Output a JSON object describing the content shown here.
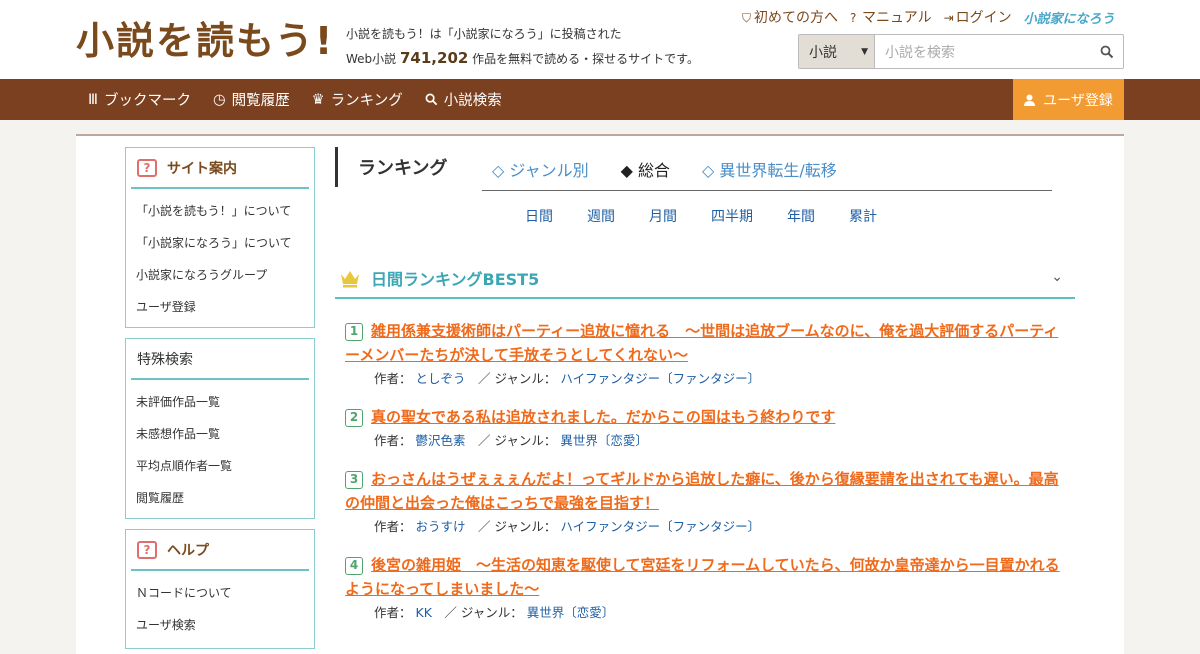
{
  "header": {
    "logo_text": "小説を読もう!",
    "tagline_line1": "小説を読もう！は「小説家になろう」に投稿された",
    "tagline_prefix": "Web小説",
    "work_count": "741,202",
    "tagline_suffix": "作品を無料で読める・探せるサイトです。",
    "links": [
      {
        "label": "初めての方へ",
        "icon": "shield-icon"
      },
      {
        "label": "マニュアル",
        "icon": "question-circle-icon"
      },
      {
        "label": "ログイン",
        "icon": "login-icon"
      }
    ],
    "partner_logo": "小説家になろう",
    "search": {
      "select_value": "小説",
      "placeholder": "小説を検索"
    }
  },
  "nav": {
    "items": [
      {
        "label": "ブックマーク",
        "icon": "bookmark-icon"
      },
      {
        "label": "閲覧履歴",
        "icon": "history-icon"
      },
      {
        "label": "ランキング",
        "icon": "crown-icon"
      },
      {
        "label": "小説検索",
        "icon": "search-icon"
      }
    ],
    "register_label": "ユーザ登録"
  },
  "sidebar": {
    "site_guide": {
      "title": "サイト案内",
      "items": [
        "「小説を読もう！」について",
        "「小説家になろう」について",
        "小説家になろうグループ",
        "ユーザ登録"
      ]
    },
    "special_search": {
      "title": "特殊検索",
      "items": [
        "未評価作品一覧",
        "未感想作品一覧",
        "平均点順作者一覧",
        "閲覧履歴"
      ]
    },
    "help": {
      "title": "ヘルプ",
      "items": [
        "Ｎコードについて",
        "ユーザ検索"
      ]
    }
  },
  "ranking": {
    "title": "ランキング",
    "tabs": [
      {
        "label": "◇ ジャンル別",
        "active": false
      },
      {
        "label": "◆ 総合",
        "active": true
      },
      {
        "label": "◇ 異世界転生/転移",
        "active": false
      }
    ],
    "periods": [
      "日間",
      "週間",
      "月間",
      "四半期",
      "年間",
      "累計"
    ],
    "best_title": "日間ランキングBEST5",
    "author_label": "作者：",
    "genre_label": "／ ジャンル：",
    "items": [
      {
        "rank": "1",
        "title": "雑用係兼支援術師はパーティー追放に憧れる　～世間は追放ブームなのに、俺を過大評価するパーティーメンバーたちが決して手放そうとしてくれない～",
        "author": "としぞう",
        "genre": "ハイファンタジー〔ファンタジー〕"
      },
      {
        "rank": "2",
        "title": "真の聖女である私は追放されました。だからこの国はもう終わりです",
        "author": "鬱沢色素",
        "genre": "異世界〔恋愛〕"
      },
      {
        "rank": "3",
        "title": "おっさんはうぜぇぇぇんだよ！ってギルドから追放した癖に、後から復縁要請を出されても遅い。最高の仲間と出会った俺はこっちで最強を目指す！",
        "author": "おうすけ",
        "genre": "ハイファンタジー〔ファンタジー〕"
      },
      {
        "rank": "4",
        "title": "後宮の雑用姫　～生活の知恵を駆使して宮廷をリフォームしていたら、何故か皇帝達から一目置かれるようになってしまいました～",
        "author": "KK",
        "genre": "異世界〔恋愛〕"
      }
    ]
  },
  "colors": {
    "brand_brown": "#7a4020",
    "accent_orange": "#f39b33",
    "teal": "#5cbfc2",
    "link_blue": "#1f5fa3",
    "title_orange": "#f06a1b"
  }
}
